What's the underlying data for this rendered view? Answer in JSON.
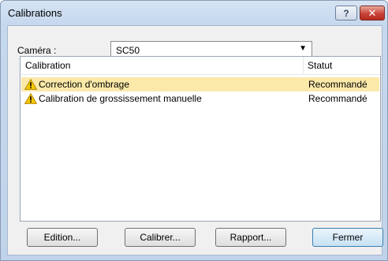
{
  "window": {
    "title": "Calibrations",
    "help_glyph": "?",
    "close_glyph": "✕"
  },
  "camera": {
    "label": "Caméra :",
    "value": "SC50"
  },
  "list": {
    "columns": [
      "Calibration",
      "Statut"
    ],
    "rows": [
      {
        "name": "Correction d'ombrage",
        "status": "Recommandé",
        "selected": true
      },
      {
        "name": "Calibration de grossissement manuelle",
        "status": "Recommandé",
        "selected": false
      }
    ]
  },
  "buttons": {
    "edition": "Edition...",
    "calibrer": "Calibrer...",
    "rapport": "Rapport...",
    "fermer": "Fermer"
  },
  "colors": {
    "selection": "#fbe9a9",
    "warning": "#f6c800"
  },
  "icons": {
    "row_icon": "warning-icon"
  }
}
